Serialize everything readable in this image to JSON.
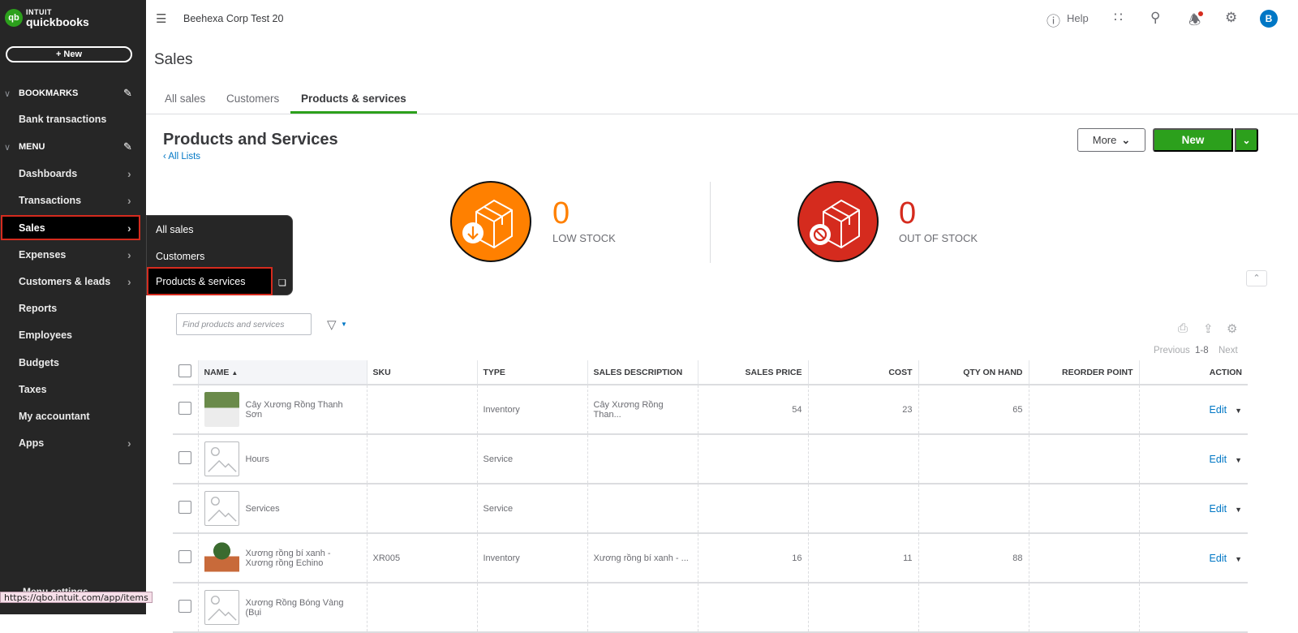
{
  "sidebar": {
    "logo_intuit": "INTUIT",
    "logo_qb": "quickbooks",
    "logo_mark": "qb",
    "new_button": "+ New",
    "bookmarks_label": "BOOKMARKS",
    "bookmark_items": [
      "Bank transactions"
    ],
    "menu_label": "MENU",
    "menu_items": [
      {
        "label": "Dashboards",
        "has_arrow": true
      },
      {
        "label": "Transactions",
        "has_arrow": true
      },
      {
        "label": "Sales",
        "has_arrow": true,
        "active": true
      },
      {
        "label": "Expenses",
        "has_arrow": true
      },
      {
        "label": "Customers & leads",
        "has_arrow": true
      },
      {
        "label": "Reports",
        "has_arrow": false
      },
      {
        "label": "Employees",
        "has_arrow": false
      },
      {
        "label": "Budgets",
        "has_arrow": false
      },
      {
        "label": "Taxes",
        "has_arrow": false
      },
      {
        "label": "My accountant",
        "has_arrow": false
      },
      {
        "label": "Apps",
        "has_arrow": true
      }
    ],
    "bottom_item_partial": "Menu settings",
    "flyout": {
      "items": [
        "All sales",
        "Customers",
        "Products & services"
      ],
      "active": "Products & services"
    }
  },
  "status_url": "https://qbo.intuit.com/app/items",
  "topbar": {
    "company": "Beehexa Corp Test 20",
    "help_label": "Help",
    "avatar_initial": "B"
  },
  "page": {
    "title": "Sales",
    "tabs": [
      {
        "label": "All sales",
        "active": false
      },
      {
        "label": "Customers",
        "active": false
      },
      {
        "label": "Products & services",
        "active": true
      }
    ],
    "section_title": "Products and Services",
    "back_link": "All Lists",
    "more_button": "More",
    "new_button": "New"
  },
  "stock": {
    "low": {
      "count": "0",
      "label": "LOW STOCK",
      "color": "#ff8000"
    },
    "out": {
      "count": "0",
      "label": "OUT OF STOCK",
      "color": "#d52b1e"
    }
  },
  "list": {
    "search_placeholder": "Find products and services",
    "pager": {
      "previous": "Previous",
      "range": "1-8",
      "next": "Next"
    },
    "columns": [
      "NAME",
      "SKU",
      "TYPE",
      "SALES DESCRIPTION",
      "SALES PRICE",
      "COST",
      "QTY ON HAND",
      "REORDER POINT",
      "ACTION"
    ],
    "rows": [
      {
        "name": "Cây Xương Rồng Thanh Sơn",
        "sku": "",
        "type": "Inventory",
        "description": "Cây Xương Rồng Than...",
        "price": "54",
        "cost": "23",
        "qty": "65",
        "reorder": "",
        "action": "Edit",
        "thumb": "photo1"
      },
      {
        "name": "Hours",
        "sku": "",
        "type": "Service",
        "description": "",
        "price": "",
        "cost": "",
        "qty": "",
        "reorder": "",
        "action": "Edit",
        "thumb": "ph"
      },
      {
        "name": "Services",
        "sku": "",
        "type": "Service",
        "description": "",
        "price": "",
        "cost": "",
        "qty": "",
        "reorder": "",
        "action": "Edit",
        "thumb": "ph"
      },
      {
        "name": "Xương rồng bí xanh - Xương rồng Echino",
        "sku": "XR005",
        "type": "Inventory",
        "description": "Xương rồng bí xanh - ...",
        "price": "16",
        "cost": "11",
        "qty": "88",
        "reorder": "",
        "action": "Edit",
        "thumb": "photo2"
      },
      {
        "name": "Xương Rồng Bóng Vàng (Bụi",
        "sku": "",
        "type": "",
        "description": "",
        "price": "",
        "cost": "",
        "qty": "",
        "reorder": "",
        "action": "",
        "thumb": "ph"
      }
    ]
  }
}
